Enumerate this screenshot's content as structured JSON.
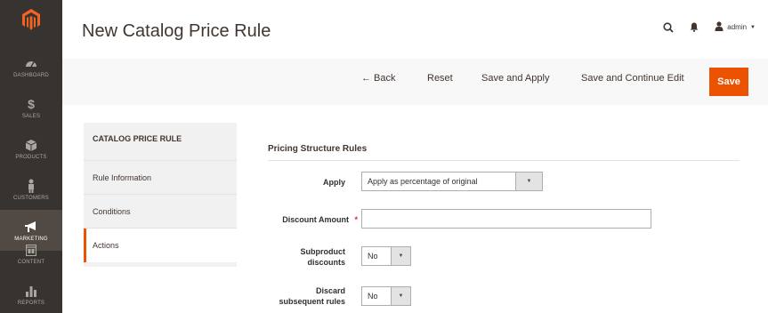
{
  "page": {
    "title": "New Catalog Price Rule"
  },
  "header": {
    "user_label": "admin"
  },
  "nav": {
    "items": [
      {
        "label": "DASHBOARD",
        "icon": "dashboard-icon"
      },
      {
        "label": "SALES",
        "icon": "dollar-icon"
      },
      {
        "label": "PRODUCTS",
        "icon": "cube-icon"
      },
      {
        "label": "CUSTOMERS",
        "icon": "person-icon"
      },
      {
        "label": "MARKETING",
        "icon": "megaphone-icon"
      },
      {
        "label": "CONTENT",
        "icon": "layout-icon"
      },
      {
        "label": "REPORTS",
        "icon": "bar-chart-icon"
      }
    ],
    "active": "MARKETING"
  },
  "actions": {
    "back": "← Back",
    "reset": "Reset",
    "save_apply": "Save and Apply",
    "save_continue": "Save and Continue Edit",
    "save": "Save"
  },
  "tabs": {
    "title": "CATALOG PRICE RULE",
    "items": [
      "Rule Information",
      "Conditions",
      "Actions"
    ],
    "active": "Actions"
  },
  "section": {
    "title": "Pricing Structure Rules"
  },
  "form": {
    "apply_label": "Apply",
    "apply_value": "Apply as percentage of original",
    "discount_label": "Discount Amount",
    "discount_required_mark": "*",
    "discount_value": "",
    "subproduct_label_line1": "Subproduct",
    "subproduct_label_line2": "discounts",
    "subproduct_value": "No",
    "discard_label_line1": "Discard",
    "discard_label_line2": "subsequent rules",
    "discard_value": "No"
  },
  "colors": {
    "accent": "#eb5202",
    "nav_bg": "#373330",
    "nav_active": "#514943"
  }
}
